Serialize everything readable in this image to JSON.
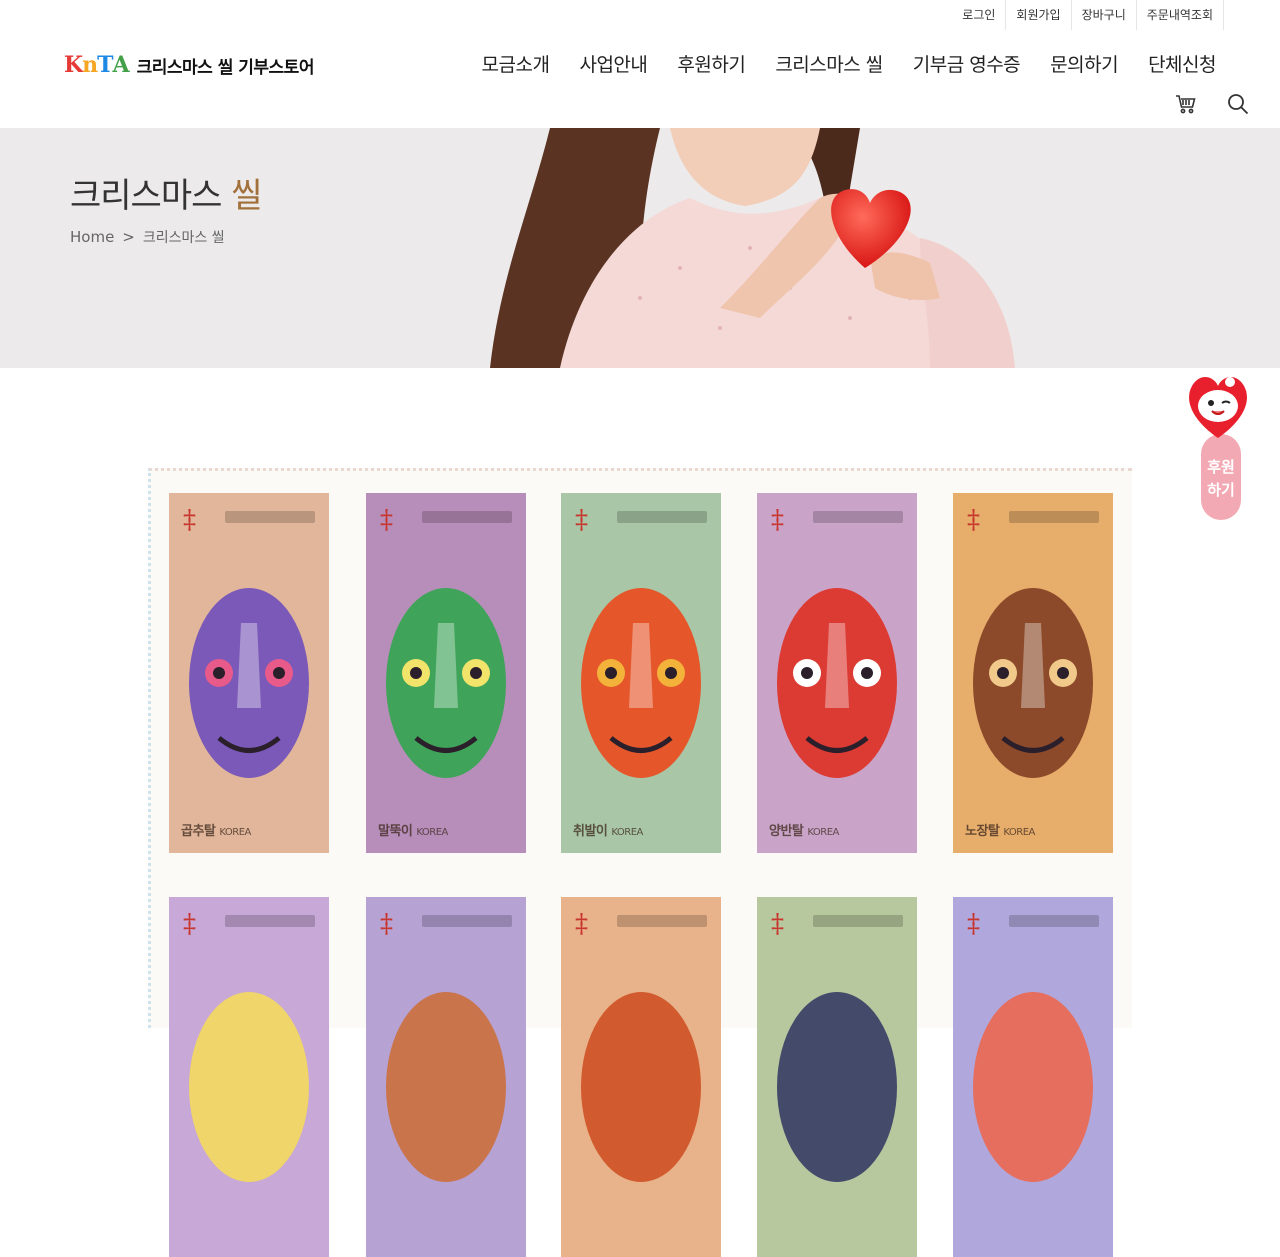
{
  "util_links": [
    "로그인",
    "회원가입",
    "장바구니",
    "주문내역조회"
  ],
  "logo": {
    "mark": [
      "K",
      "n",
      "T",
      "A"
    ],
    "mark_colors": [
      "#e53935",
      "#f6a623",
      "#1e88e5",
      "#43a047"
    ],
    "text": "크리스마스 씰 기부스토어"
  },
  "gnb": [
    "모금소개",
    "사업안내",
    "후원하기",
    "크리스마스 씰",
    "기부금 영수증",
    "문의하기",
    "단체신청"
  ],
  "icons": {
    "cart": "cart-icon",
    "search": "search-icon"
  },
  "visual": {
    "title_main": "크리스마스",
    "title_accent": "씰",
    "accent_color": "#a2703b",
    "breadcrumb": {
      "home": "Home",
      "sep": ">",
      "current": "크리스마스 씰"
    }
  },
  "stamps": {
    "row1": [
      {
        "bg": "#e2b69a",
        "mask": "#7b59b8",
        "eye": "#e85a8a",
        "text": "곱추탈",
        "sub": "KOREA"
      },
      {
        "bg": "#b78db9",
        "mask": "#3fa45a",
        "eye": "#f2e46a",
        "text": "말뚝이",
        "sub": "KOREA"
      },
      {
        "bg": "#a9c7a6",
        "mask": "#e5572b",
        "eye": "#f3b33a",
        "text": "취발이",
        "sub": "KOREA"
      },
      {
        "bg": "#c9a4c8",
        "mask": "#dc3b33",
        "eye": "#ffffff",
        "text": "양반탈",
        "sub": "KOREA"
      },
      {
        "bg": "#e7ad6b",
        "mask": "#8d4a2a",
        "eye": "#f0c98b",
        "text": "노장탈",
        "sub": "KOREA"
      }
    ],
    "row2": [
      {
        "bg": "#c7a8d6",
        "mask": "#efd56a"
      },
      {
        "bg": "#b6a2d3",
        "mask": "#c9744a"
      },
      {
        "bg": "#e8b28a",
        "mask": "#d15b2e"
      },
      {
        "bg": "#b7c89f",
        "mask": "#444a6a"
      },
      {
        "bg": "#b0a8dc",
        "mask": "#e56e5e"
      }
    ]
  },
  "float_donate": {
    "line1": "후원",
    "line2": "하기"
  }
}
